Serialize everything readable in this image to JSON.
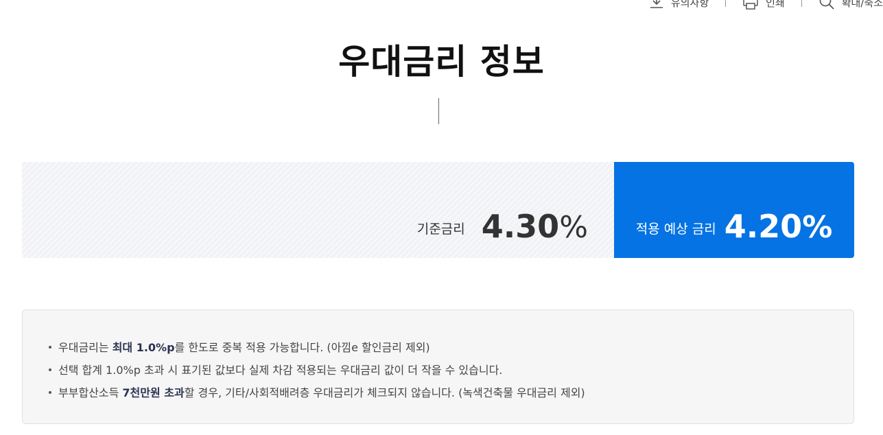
{
  "toolbar": {
    "items": [
      {
        "label": "유의사항",
        "icon": "download-icon"
      },
      {
        "label": "인쇄",
        "icon": "printer-icon"
      },
      {
        "label": "확대/축소",
        "icon": "search-icon"
      }
    ]
  },
  "page": {
    "title": "우대금리 정보"
  },
  "rates": {
    "base_label": "기준금리",
    "base_value": "4.30",
    "base_unit": "%",
    "applied_label": "적용 예상 금리",
    "applied_value": "4.20",
    "applied_unit": "%"
  },
  "notices": [
    {
      "pre": "우대금리는 ",
      "bold": "최대 1.0%p",
      "post": "를 한도로 중복 적용 가능합니다. (아낌e 할인금리 제외)"
    },
    {
      "pre": "선택 합계 1.0%p 초과 시 표기된 값보다 실제 차감 적용되는 우대금리 값이 더 작을 수 있습니다.",
      "bold": "",
      "post": ""
    },
    {
      "pre": "부부합산소득 ",
      "bold": "7천만원 초과",
      "post": "할 경우, 기타/사회적배려층 우대금리가 체크되지 않습니다. (녹색건축물 우대금리 제외)"
    }
  ],
  "colors": {
    "accent": "#0673e4",
    "base_panel": "#f1f2f6",
    "notice_bg": "#f6f6f7"
  }
}
